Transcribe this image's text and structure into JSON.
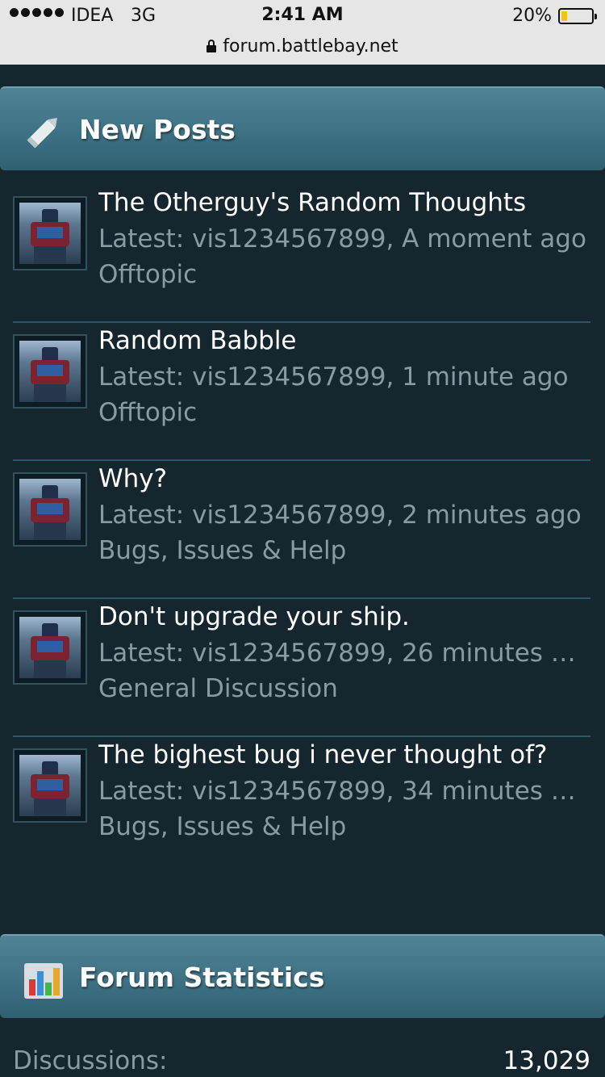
{
  "status_bar": {
    "carrier": "IDEA",
    "network": "3G",
    "time": "2:41 AM",
    "battery_percent": "20%",
    "battery_level": 0.2,
    "battery_color": "#f0c419"
  },
  "address_bar": {
    "url": "forum.battlebay.net",
    "lock_icon": "lock-icon"
  },
  "new_posts": {
    "title": "New Posts",
    "icon": "pencil-icon",
    "items": [
      {
        "title": "The Otherguy's Random Thoughts",
        "latest": "Latest: vis1234567899, A moment ago",
        "forum": "Offtopic"
      },
      {
        "title": "Random Babble",
        "latest": "Latest: vis1234567899, 1 minute ago",
        "forum": "Offtopic"
      },
      {
        "title": "Why?",
        "latest": "Latest: vis1234567899, 2 minutes ago",
        "forum": "Bugs, Issues & Help"
      },
      {
        "title": "Don't upgrade your ship.",
        "latest": "Latest: vis1234567899, 26 minutes a...",
        "forum": "General Discussion"
      },
      {
        "title": "The bighest bug i never thought of?",
        "latest": "Latest: vis1234567899, 34 minutes a...",
        "forum": "Bugs, Issues & Help"
      }
    ]
  },
  "forum_statistics": {
    "title": "Forum Statistics",
    "icon": "bar-chart-icon",
    "rows": [
      {
        "label": "Discussions:",
        "value": "13,029"
      }
    ]
  },
  "colors": {
    "background": "#16262f",
    "header_gradient_top": "#4f8496",
    "header_gradient_bottom": "#2f6173",
    "muted_text": "#8a9aa2",
    "divider": "#2c5567"
  }
}
